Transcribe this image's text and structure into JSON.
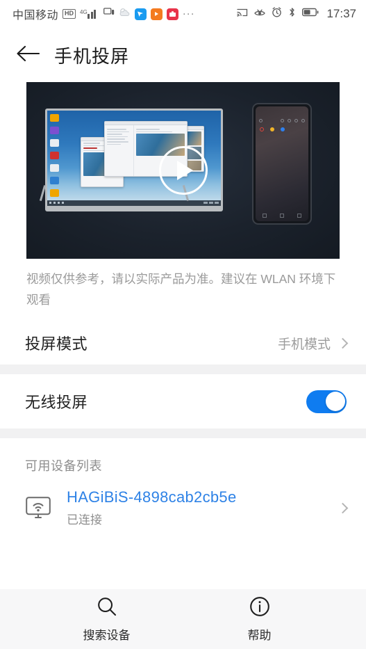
{
  "statusbar": {
    "carrier": "中国移动",
    "hd_badge": "HD",
    "network_type": "4G",
    "icons_left": [
      "hd-icon",
      "signal-icon",
      "screencast-small-icon",
      "weather-icon",
      "app-blue-icon",
      "app-orange-icon",
      "app-red-icon",
      "more-dots-icon"
    ],
    "more_dots": "···",
    "icons_right": [
      "cast-icon",
      "eye-comfort-icon",
      "alarm-icon",
      "bluetooth-icon",
      "battery-icon"
    ],
    "time": "17:37"
  },
  "header": {
    "back_icon": "back-arrow-icon",
    "title": "手机投屏"
  },
  "video": {
    "play_icon": "play-button-icon",
    "caption": "视频仅供参考，请以实际产品为准。建议在 WLAN 环境下观看"
  },
  "projection_mode": {
    "label": "投屏模式",
    "value": "手机模式",
    "chevron": "chevron-right-icon"
  },
  "wireless_projection": {
    "label": "无线投屏",
    "enabled": true,
    "toggle_color": "#0f7cf0"
  },
  "device_list": {
    "section_title": "可用设备列表",
    "devices": [
      {
        "icon": "cast-monitor-icon",
        "name": "HAGiBiS-4898cab2cb5e",
        "status": "已连接",
        "name_color": "#2e82e6",
        "chevron": "chevron-right-icon"
      }
    ]
  },
  "bottombar": {
    "items": [
      {
        "icon": "search-icon",
        "label": "搜索设备"
      },
      {
        "icon": "info-icon",
        "label": "帮助"
      }
    ]
  }
}
